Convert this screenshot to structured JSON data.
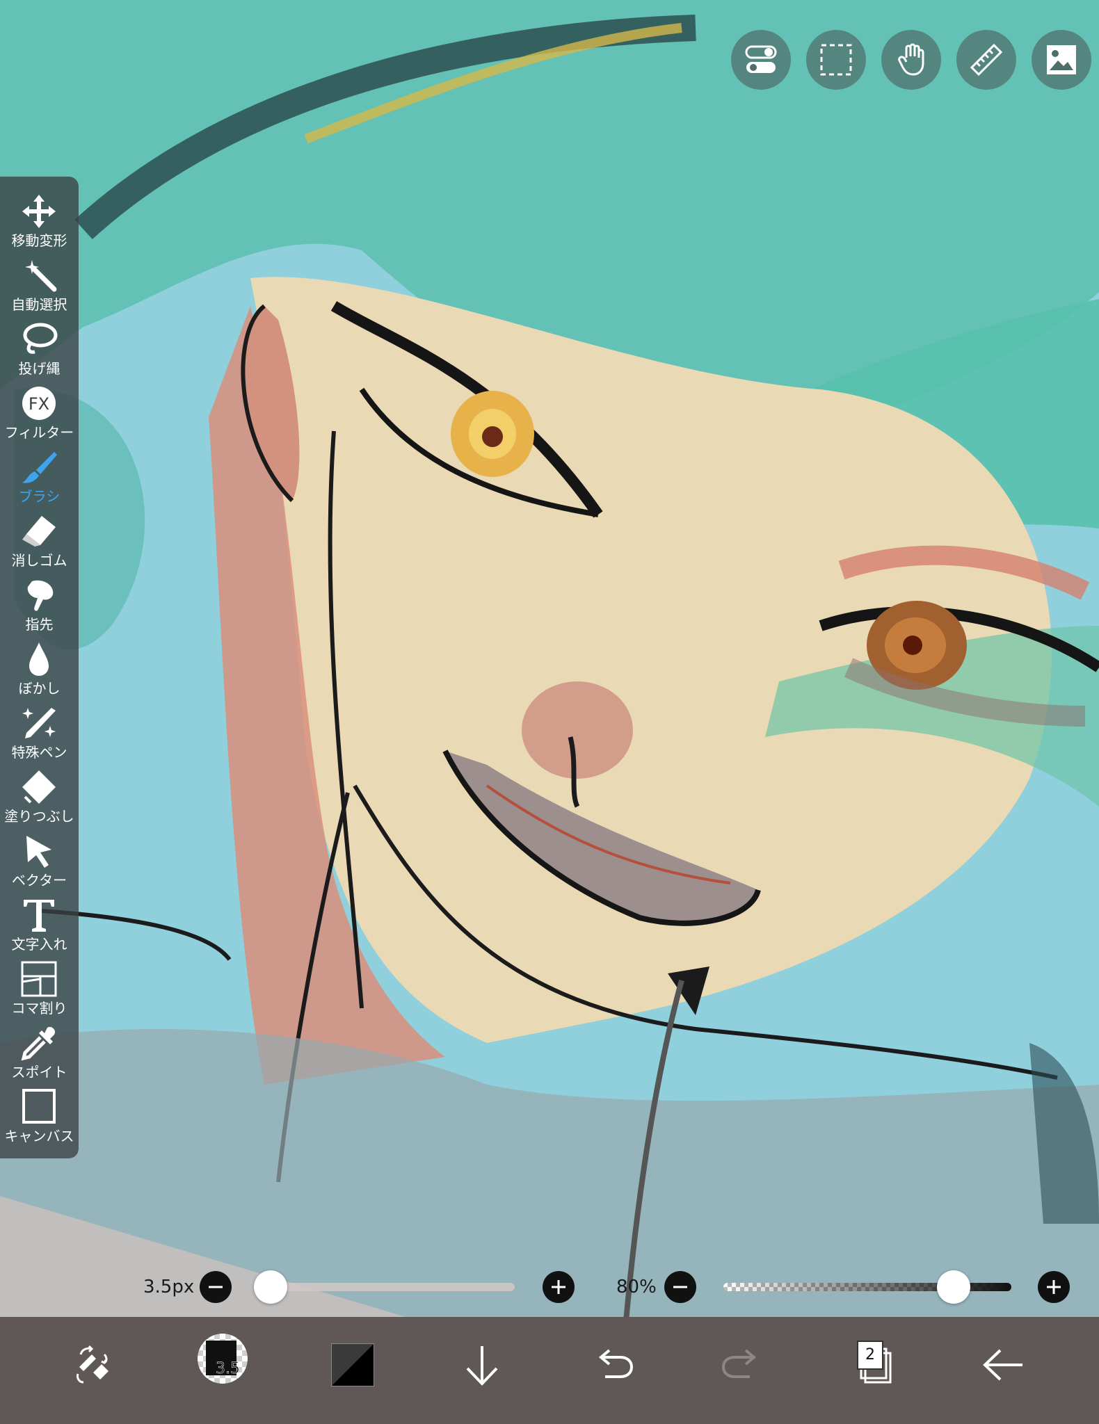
{
  "toolbar": {
    "tools": [
      {
        "label": "移動変形",
        "icon": "move-arrows-icon"
      },
      {
        "label": "自動選択",
        "icon": "magic-wand-icon"
      },
      {
        "label": "投げ縄",
        "icon": "lasso-icon"
      },
      {
        "label": "フィルター",
        "icon": "fx-icon"
      },
      {
        "label": "ブラシ",
        "icon": "brush-icon",
        "active": true
      },
      {
        "label": "消しゴム",
        "icon": "eraser-icon"
      },
      {
        "label": "指先",
        "icon": "finger-smudge-icon"
      },
      {
        "label": "ぼかし",
        "icon": "blur-drop-icon"
      },
      {
        "label": "特殊ペン",
        "icon": "special-pen-icon"
      },
      {
        "label": "塗りつぶし",
        "icon": "fill-bucket-icon"
      },
      {
        "label": "ベクター",
        "icon": "vector-cursor-icon"
      },
      {
        "label": "文字入れ",
        "icon": "text-icon"
      },
      {
        "label": "コマ割り",
        "icon": "panel-frame-icon"
      },
      {
        "label": "スポイト",
        "icon": "eyedropper-icon"
      },
      {
        "label": "キャンバス",
        "icon": "canvas-icon"
      }
    ],
    "active_color": "#3fa3ef"
  },
  "top_buttons": [
    "toggle-icon",
    "selection-icon",
    "hand-icon",
    "ruler-icon",
    "image-icon"
  ],
  "brush_size": {
    "label": "3.5px",
    "value_fraction": 0.02
  },
  "opacity": {
    "label": "80%",
    "value_fraction": 0.8
  },
  "bottom_bar": {
    "brush_badge": "3.5",
    "layer_count": "2",
    "icons": [
      "swap-tools-icon",
      "brush-size-icon",
      "color-icon",
      "download-icon",
      "undo-icon",
      "redo-icon",
      "layers-icon",
      "back-arrow-icon"
    ]
  }
}
